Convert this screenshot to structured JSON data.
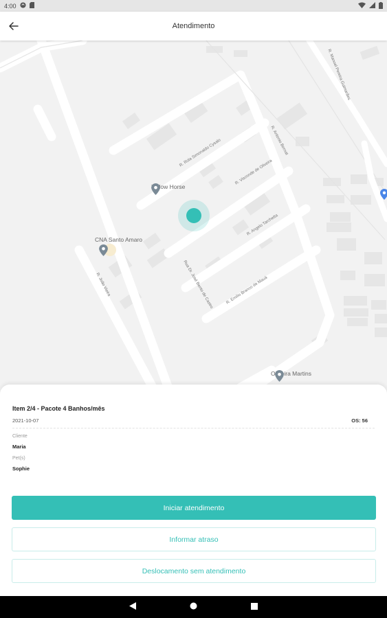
{
  "status_bar": {
    "time": "4:00"
  },
  "app_bar": {
    "title": "Atendimento"
  },
  "map": {
    "pois": {
      "yellow_horse": "Yellow Horse",
      "cna": "CNA Santo Amaro",
      "oliveira": "Oliveira Martins"
    },
    "streets": {
      "simonaldo": "R. Rola Simonaldo Cysalo",
      "antonio": "R. Antonio Bernat",
      "visconde": "R. Visconde de Oliveira",
      "angelo": "R. Angelo Tarchetta",
      "baraodemaua": "R. Emilio Branco de Mauá",
      "dr_jose": "Rua Dr. José Bento de Castro",
      "joao": "R. João Vieira",
      "manoel": "R. Manoel Pereira Guimarães"
    }
  },
  "order": {
    "title": "Item 2/4 - Pacote 4 Banhos/mês",
    "date": "2021-10-07",
    "os": "OS: 56",
    "client_label": "Cliente",
    "client_value": "Maria",
    "pets_label": "Pet(s)",
    "pets_value": "Sophie"
  },
  "actions": {
    "start": "Iniciar atendimento",
    "delay": "Informar atraso",
    "move": "Deslocamento sem atendimento"
  },
  "colors": {
    "accent": "#34bfb6",
    "map_bg": "#f2f2f2"
  }
}
